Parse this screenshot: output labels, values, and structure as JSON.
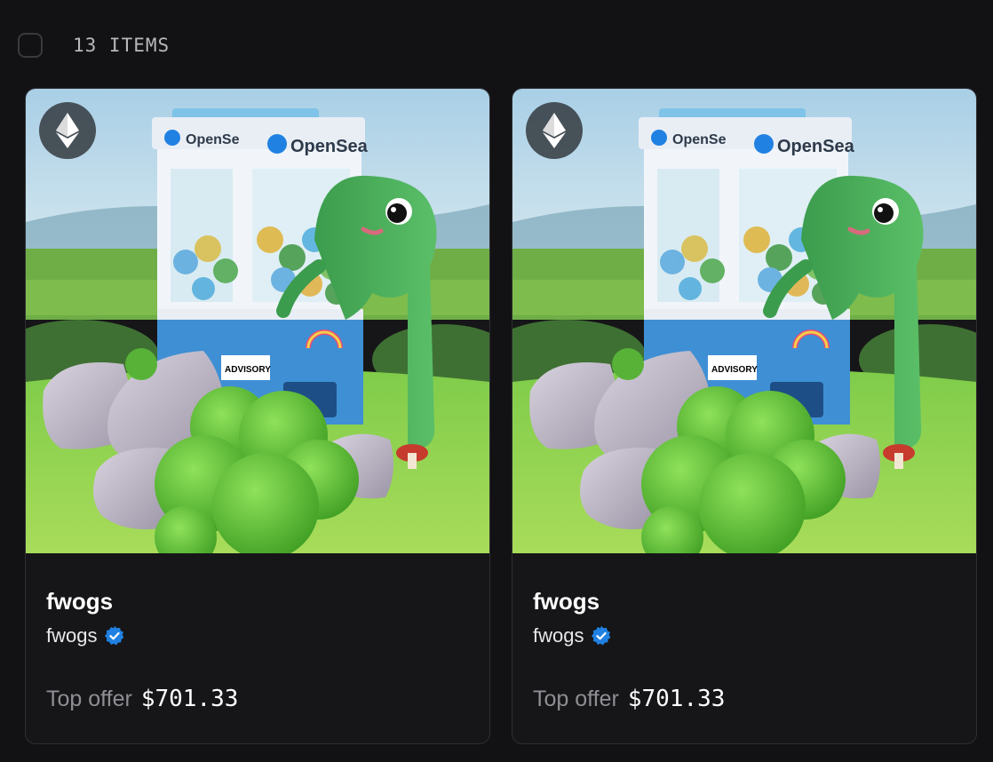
{
  "header": {
    "count_label": "13 ITEMS"
  },
  "items": [
    {
      "name": "fwogs",
      "collection": "fwogs",
      "verified": true,
      "chain_icon": "ethereum-icon",
      "offer_label": "Top offer",
      "offer_price": "$701.33",
      "image_labels": {
        "machine_top": "OpenSea",
        "machine_side": "OpenSe",
        "sticker": "ADVISORY"
      }
    },
    {
      "name": "fwogs",
      "collection": "fwogs",
      "verified": true,
      "chain_icon": "ethereum-icon",
      "offer_label": "Top offer",
      "offer_price": "$701.33",
      "image_labels": {
        "machine_top": "OpenSea",
        "machine_side": "OpenSe",
        "sticker": "ADVISORY"
      }
    }
  ],
  "colors": {
    "background": "#121214",
    "card_border": "#2f2f33",
    "verified_blue": "#2081e2",
    "muted_text": "#8e8e94"
  }
}
